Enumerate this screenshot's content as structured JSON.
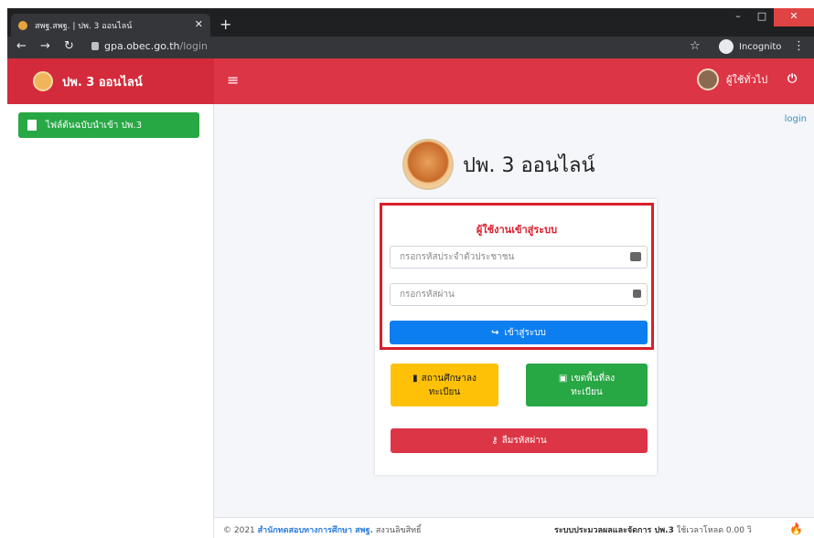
{
  "browser": {
    "tab_title": "สพฐ.สพฐ. | ปพ. 3 ออนไลน์",
    "new_tab": "+",
    "url_domain": "gpa.obec.go.th",
    "url_path": "/login",
    "incognito_label": "Incognito"
  },
  "navbar": {
    "brand": "ปพ. 3 ออนไลน์",
    "user_label": "ผู้ใช้ทั่วไป"
  },
  "sidebar": {
    "items": [
      {
        "label": "ไฟล์ต้นฉบับนำเข้า ปพ.3"
      }
    ]
  },
  "content": {
    "login_link": "login",
    "app_title": "ปพ. 3 ออนไลน์",
    "login_header": "ผู้ใช้งานเข้าสู่ระบบ",
    "id_placeholder": "กรอกรหัสประจำตัวประชาชน",
    "password_placeholder": "กรอกรหัสผ่าน",
    "login_button": "เข้าสู่ระบบ",
    "school_register_line1": "สถานศึกษาลง",
    "school_register_line2": "ทะเบียน",
    "area_register_line1": "เขตพื้นที่ลง",
    "area_register_line2": "ทะเบียน",
    "forgot_password": "ลืมรหัสผ่าน"
  },
  "footer": {
    "year": "© 2021",
    "org": "สำนักทดสอบทางการศึกษา สพฐ.",
    "rights": "สงวนลิขสิทธิ์",
    "system_label": "ระบบประมวลผลและจัดการ ปพ.3",
    "load_time": "ใช้เวลาโหลด 0.00 วิ"
  },
  "colors": {
    "navbar": "#dc3545",
    "login_border": "#d81f2c",
    "login_button": "#0d7ef0",
    "yellow_button": "#ffc107",
    "green_button": "#28a745"
  }
}
